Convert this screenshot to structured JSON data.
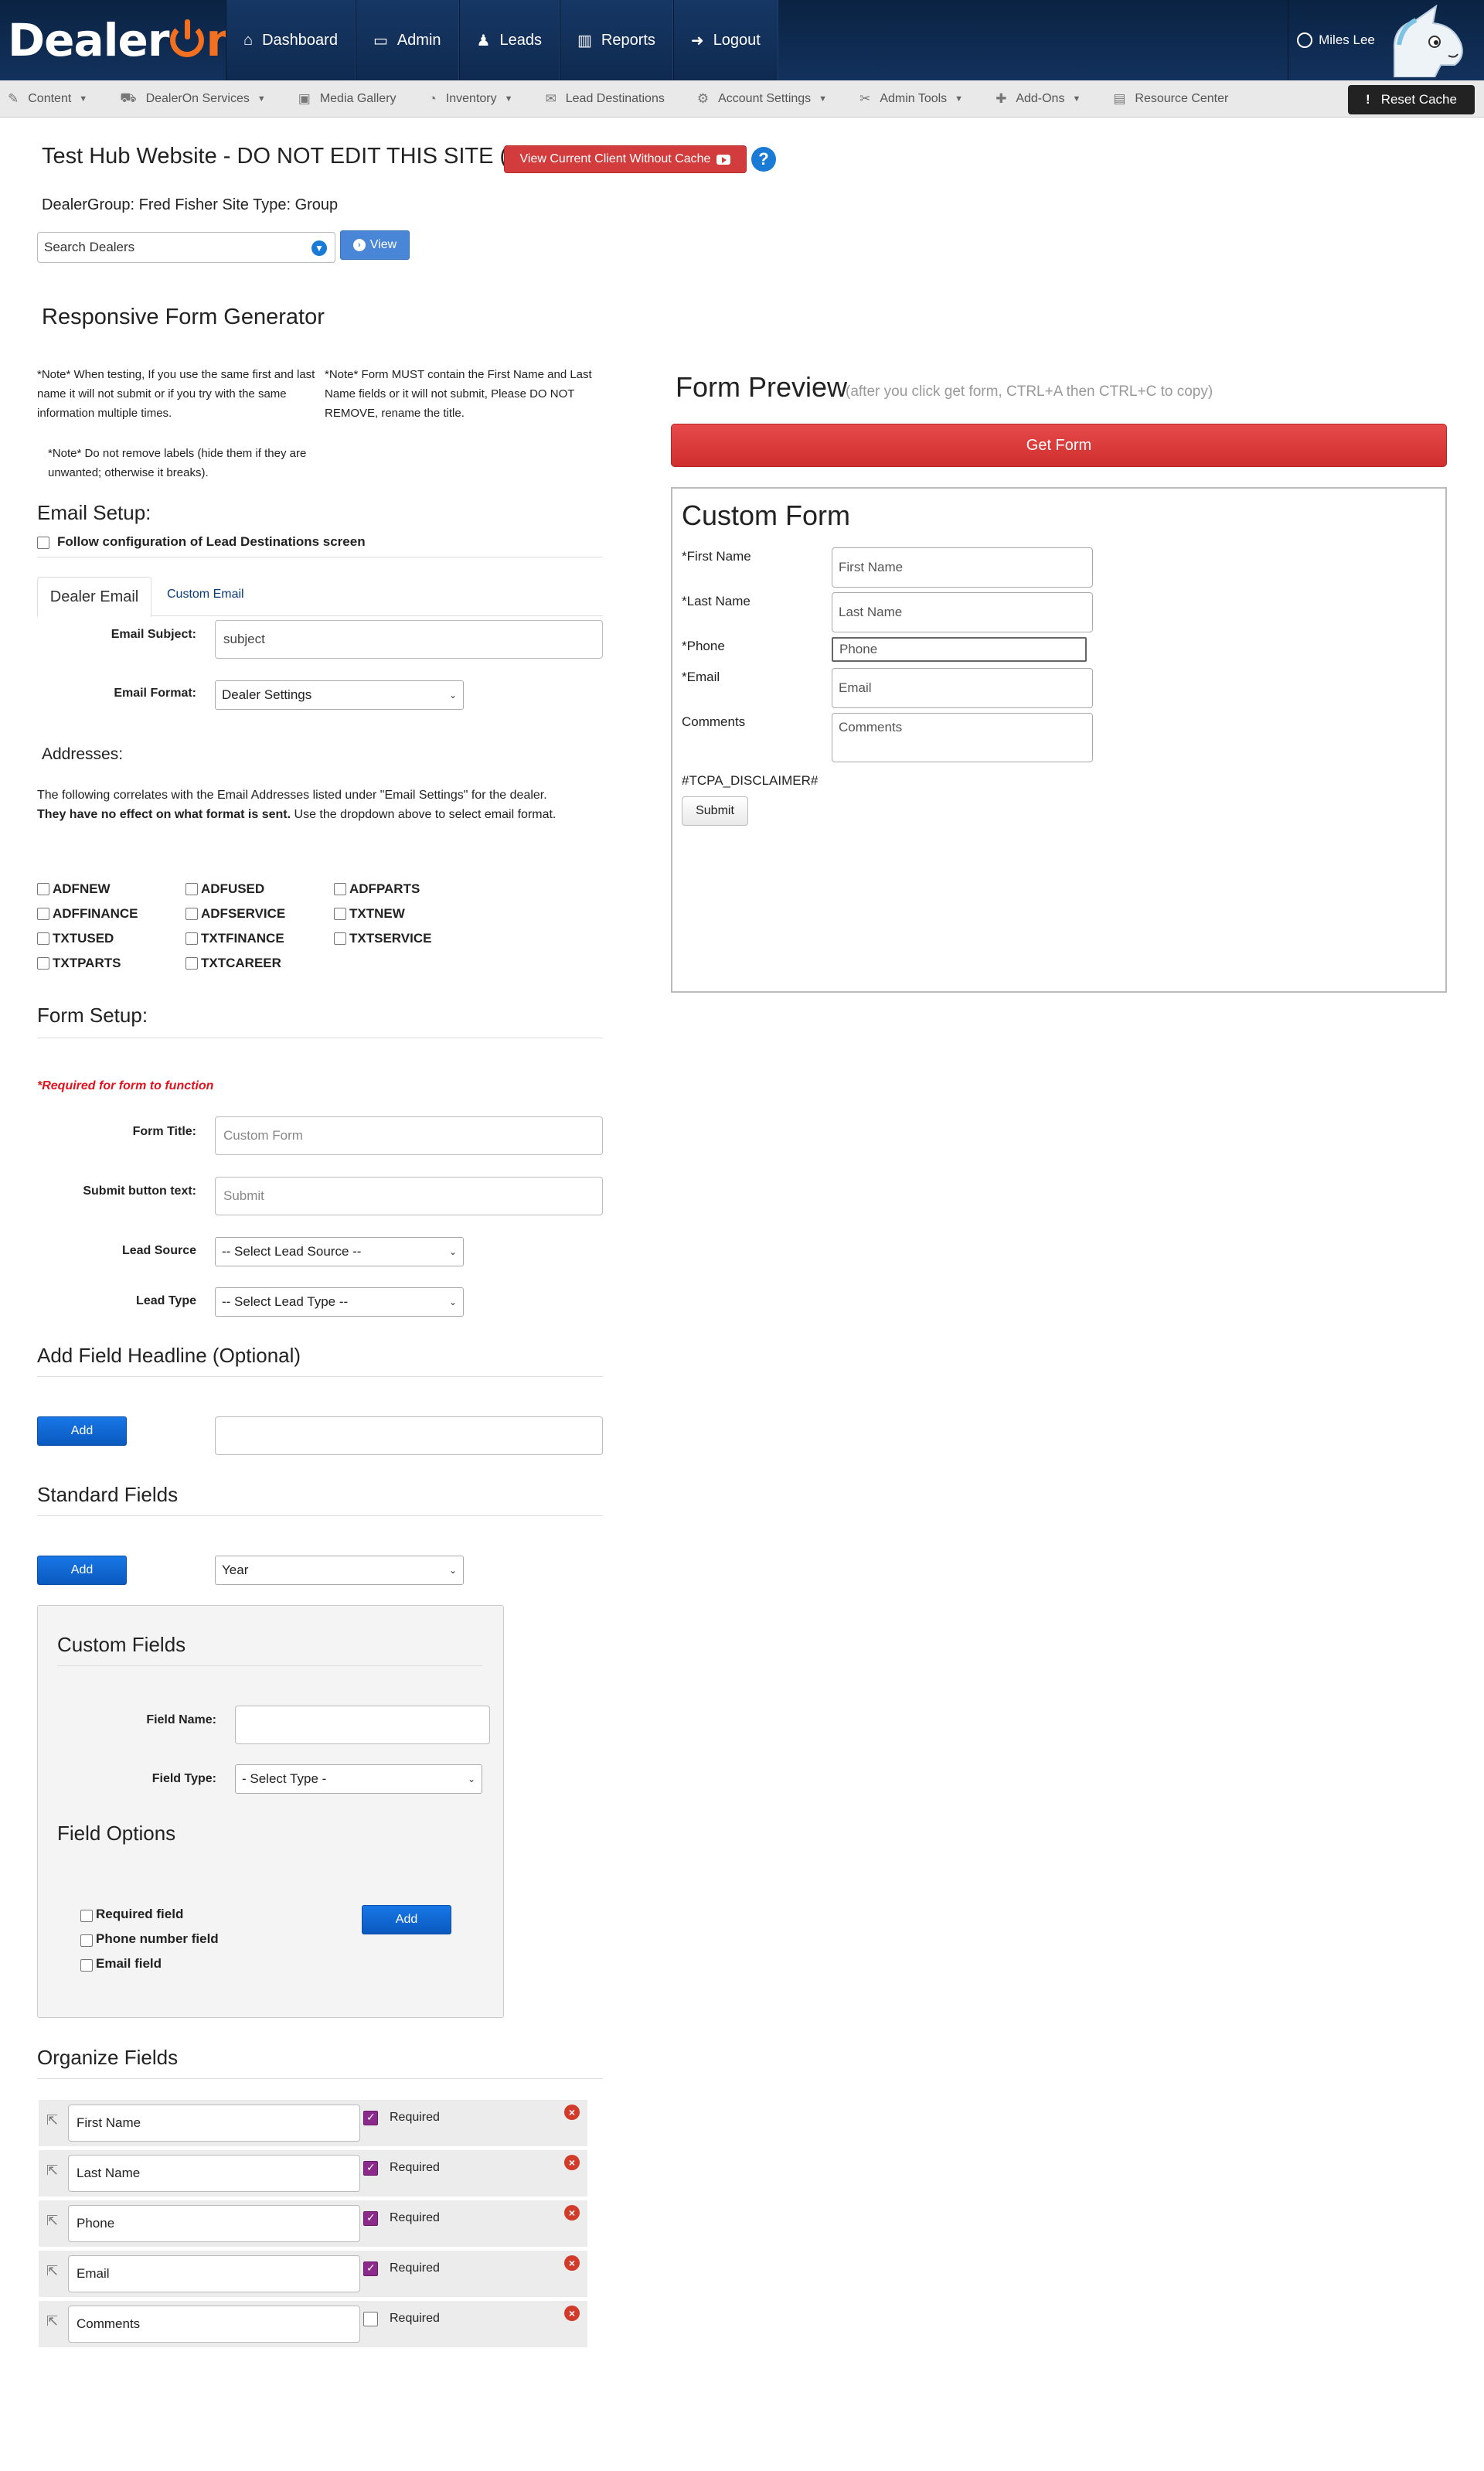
{
  "brand": {
    "logo_a": "Dealer",
    "logo_b": "n"
  },
  "nav": {
    "items": [
      {
        "icon": "home-icon",
        "glyph": "⌂",
        "label": "Dashboard"
      },
      {
        "icon": "monitor-icon",
        "glyph": "▭",
        "label": "Admin"
      },
      {
        "icon": "users-icon",
        "glyph": "♟",
        "label": "Leads"
      },
      {
        "icon": "bar-chart-icon",
        "glyph": "▥",
        "label": "Reports"
      },
      {
        "icon": "logout-icon",
        "glyph": "➜",
        "label": "Logout"
      }
    ],
    "user": "Miles Lee"
  },
  "subnav": {
    "items": [
      {
        "label": "Content",
        "dropdown": true
      },
      {
        "label": "DealerOn Services",
        "dropdown": true
      },
      {
        "label": "Media Gallery",
        "dropdown": false
      },
      {
        "label": "Inventory",
        "dropdown": true
      },
      {
        "label": "Lead Destinations",
        "dropdown": false
      },
      {
        "label": "Account Settings",
        "dropdown": true
      },
      {
        "label": "Admin Tools",
        "dropdown": true
      },
      {
        "label": "Add-Ons",
        "dropdown": true
      },
      {
        "label": "Resource Center",
        "dropdown": false
      }
    ],
    "reset_cache": "Reset Cache"
  },
  "page": {
    "title": "Test Hub Website - DO NOT EDIT THIS SITE (1)",
    "view_client_btn": "View Current Client Without Cache",
    "dealergroup_label": "DealerGroup:",
    "dealergroup_value": "Fred Fisher",
    "sitetype_label": "Site Type:",
    "sitetype_value": "Group",
    "search_dealers": "Search Dealers",
    "view_btn": "View"
  },
  "generator": {
    "title": "Responsive Form Generator",
    "note1": "*Note* When testing, If you use the same first and last name it will not submit or if you try with the same information multiple times.",
    "note2": "*Note* Form MUST contain the First Name and Last Name fields or it will not submit, Please DO NOT REMOVE, rename the title.",
    "note3": "*Note* Do not remove labels (hide them if they are unwanted; otherwise it breaks)."
  },
  "email_setup": {
    "heading": "Email Setup:",
    "follow_label": "Follow configuration of Lead Destinations screen",
    "tab_dealer": "Dealer Email",
    "tab_custom": "Custom Email",
    "subject_label": "Email Subject:",
    "subject_value": "subject",
    "format_label": "Email Format:",
    "format_value": "Dealer Settings",
    "addresses_heading": "Addresses:",
    "addresses_text": "The following correlates with the Email Addresses listed under \"Email Settings\" for the dealer.",
    "addresses_bold": "They have no effect on what format is sent.",
    "addresses_tail": "Use the dropdown above to select email format.",
    "address_checks": [
      "ADFNEW",
      "ADFUSED",
      "ADFPARTS",
      "ADFFINANCE",
      "ADFSERVICE",
      "TXTNEW",
      "TXTUSED",
      "TXTFINANCE",
      "TXTSERVICE",
      "TXTPARTS",
      "TXTCAREER"
    ]
  },
  "form_setup": {
    "heading": "Form Setup:",
    "required_note": "*Required for form to function",
    "title_label": "Form Title:",
    "title_placeholder": "Custom Form",
    "submit_label": "Submit button text:",
    "submit_placeholder": "Submit",
    "lead_source_label": "Lead Source",
    "lead_source_value": "-- Select Lead Source --",
    "lead_type_label": "Lead Type",
    "lead_type_value": "-- Select Lead Type --"
  },
  "headline": {
    "heading": "Add Field Headline (Optional)",
    "add": "Add"
  },
  "standard": {
    "heading": "Standard Fields",
    "add": "Add",
    "select_value": "Year"
  },
  "custom": {
    "heading": "Custom Fields",
    "field_name_label": "Field Name:",
    "field_type_label": "Field Type:",
    "field_type_value": "- Select Type -",
    "options_heading": "Field Options",
    "opt_required": "Required field",
    "opt_phone": "Phone number field",
    "opt_email": "Email field",
    "add": "Add"
  },
  "organize": {
    "heading": "Organize Fields",
    "required_label": "Required",
    "rows": [
      {
        "value": "First Name",
        "required": true
      },
      {
        "value": "Last Name",
        "required": true
      },
      {
        "value": "Phone",
        "required": true
      },
      {
        "value": "Email",
        "required": true
      },
      {
        "value": "Comments",
        "required": false
      }
    ]
  },
  "preview": {
    "title": "Form Preview",
    "subtitle": "(after you click get form, CTRL+A then CTRL+C to copy)",
    "get_form": "Get Form",
    "form_title": "Custom Form",
    "fields": [
      {
        "label": "*First Name",
        "placeholder": "First Name"
      },
      {
        "label": "*Last Name",
        "placeholder": "Last Name"
      },
      {
        "label": "*Phone",
        "placeholder": "Phone"
      },
      {
        "label": "*Email",
        "placeholder": "Email"
      },
      {
        "label": "Comments",
        "placeholder": "Comments"
      }
    ],
    "disclaimer": "#TCPA_DISCLAIMER#",
    "submit": "Submit"
  },
  "colors": {
    "nav_bg": "#0b2343",
    "accent_orange": "#f37021",
    "primary_blue": "#0a59bf",
    "danger_red": "#d33c3c"
  }
}
